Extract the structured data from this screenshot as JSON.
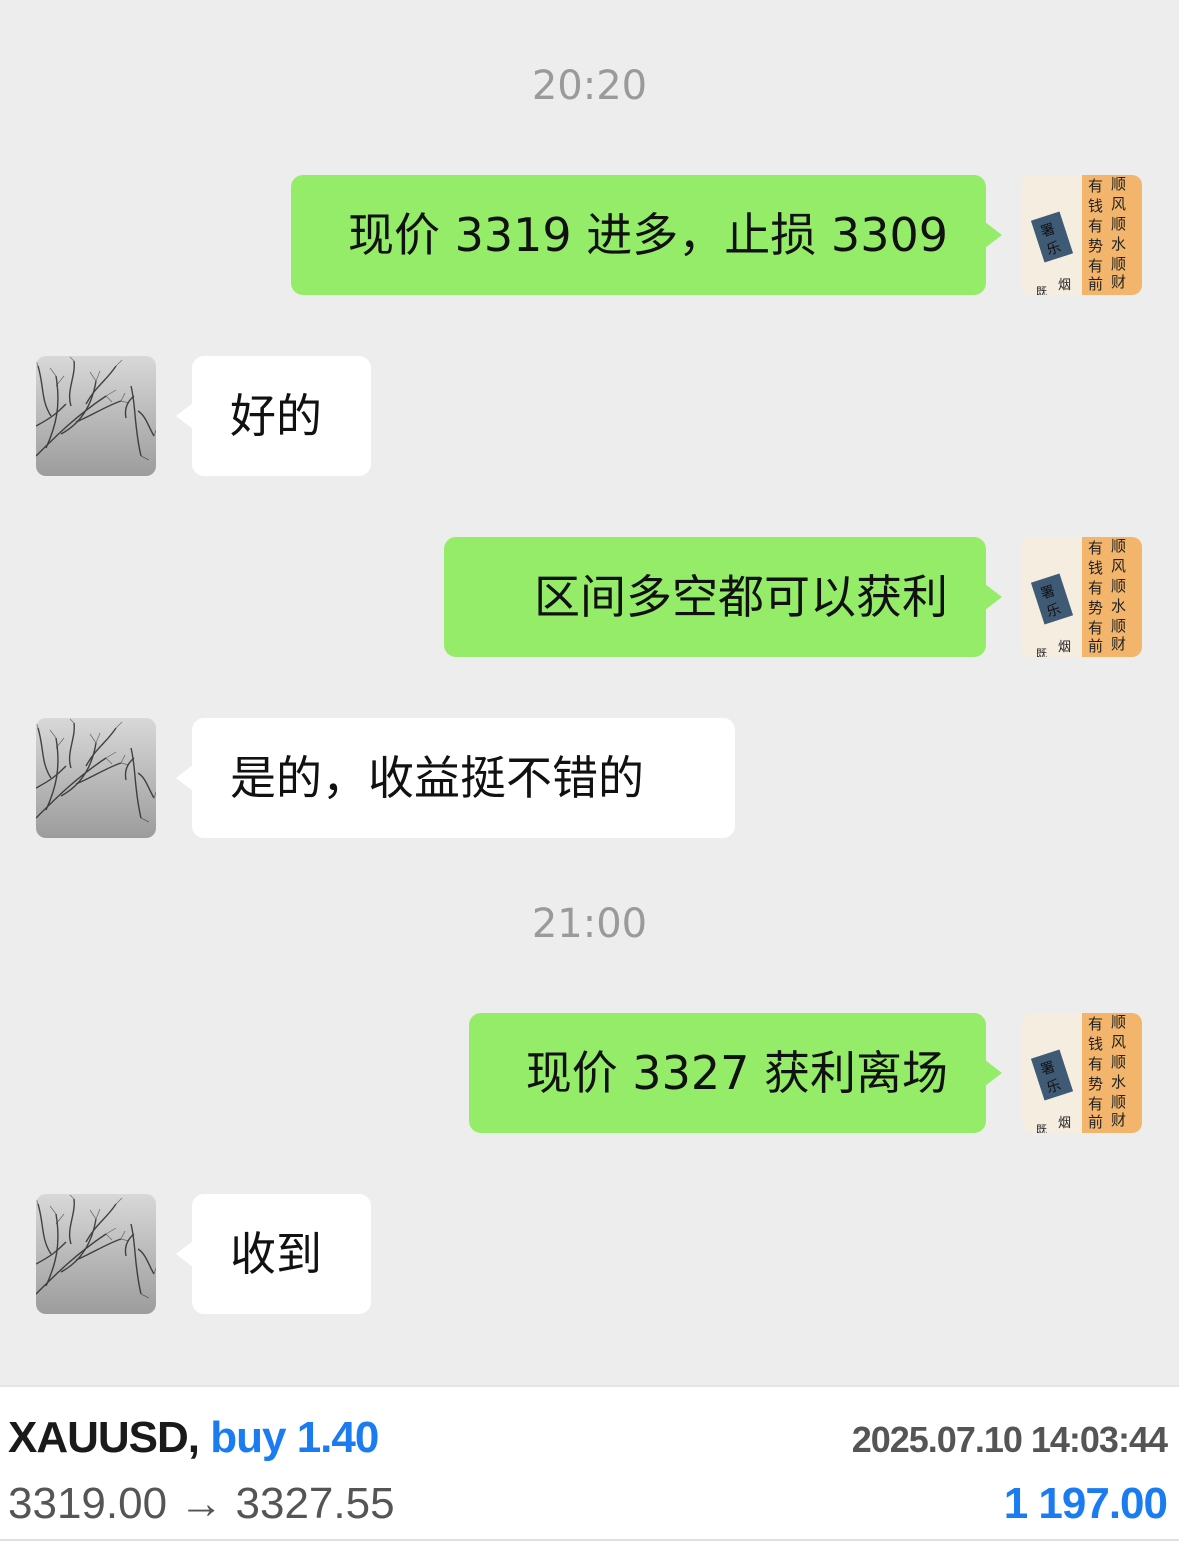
{
  "chat": {
    "timestamps": [
      "20:20",
      "21:00"
    ],
    "messages": [
      {
        "sender": "me",
        "text": "现价 3319 进多，止损 3309"
      },
      {
        "sender": "them",
        "text": "好的"
      },
      {
        "sender": "me",
        "text": "区间多空都可以获利"
      },
      {
        "sender": "them",
        "text": "是的，收益挺不错的"
      },
      {
        "sender": "me",
        "text": "现价 3327 获利离场"
      },
      {
        "sender": "them",
        "text": "收到"
      }
    ],
    "my_avatar_icon": "calligraphy-avatar-icon",
    "their_avatar_icon": "tree-branches-avatar-icon"
  },
  "trade": {
    "symbol": "XAUUSD,",
    "side": "buy 1.40",
    "datetime": "2025.07.10 14:03:44",
    "prices": "3319.00 → 3327.55",
    "profit": "1 197.00"
  },
  "colors": {
    "my_bubble": "#95ec69",
    "their_bubble": "#ffffff",
    "background": "#ededed",
    "accent_blue": "#1a7cf0"
  }
}
